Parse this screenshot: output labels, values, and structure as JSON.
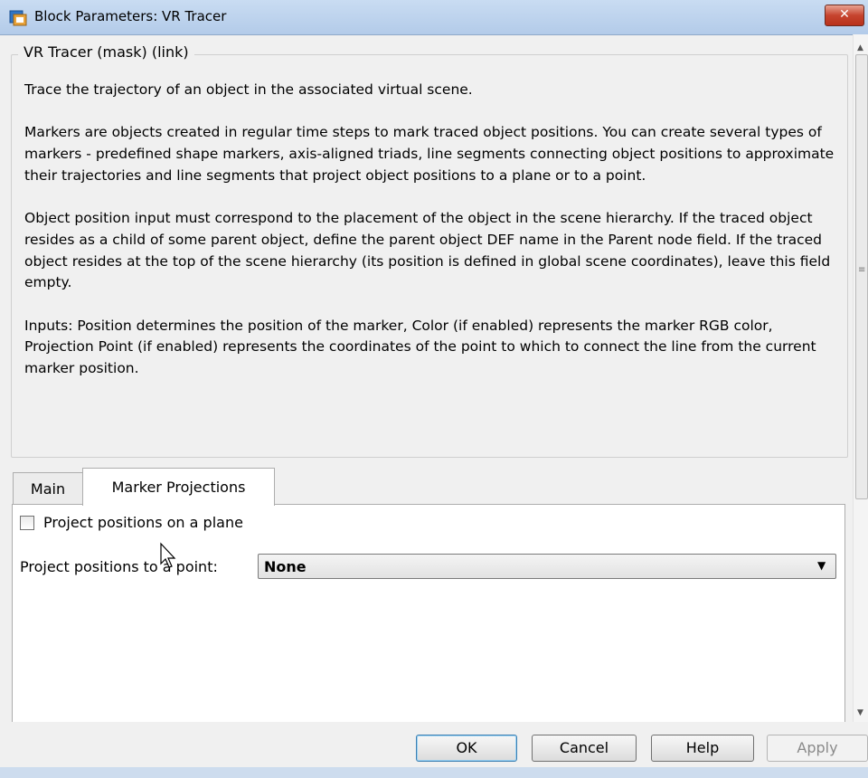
{
  "window": {
    "title": "Block Parameters: VR Tracer",
    "close_label": "✕"
  },
  "description": {
    "legend": "VR Tracer (mask) (link)",
    "paragraphs": [
      "Trace the trajectory of an object in the associated virtual scene.",
      "Markers are objects created in regular time steps to mark traced object positions. You can create several types of markers - predefined shape markers, axis-aligned triads, line segments connecting object positions to approximate their trajectories and line segments that project object positions to a plane or to a point.",
      "Object position input must correspond to the placement of the object in the scene hierarchy. If the traced object resides as a child of some parent object, define the parent object DEF name in the Parent node field. If the traced object resides at the top of the scene hierarchy (its position is defined in global scene coordinates), leave this field empty.",
      "Inputs: Position determines the position of the marker, Color (if enabled) represents the marker RGB color, Projection Point (if enabled) represents the coordinates of the point to which to connect the line from the current marker position."
    ]
  },
  "tabs": [
    {
      "label": "Main",
      "active": false
    },
    {
      "label": "Marker Projections",
      "active": true
    }
  ],
  "marker_projections": {
    "plane_checkbox": {
      "label": "Project positions on a plane",
      "checked": false
    },
    "point_select": {
      "label": "Project positions to a point:",
      "value": "None"
    }
  },
  "buttons": {
    "ok": "OK",
    "cancel": "Cancel",
    "help": "Help",
    "apply": "Apply"
  },
  "colors": {
    "titlebar": "#b9d1ea",
    "close_button": "#c74631",
    "panel_background": "#f0f0f0"
  }
}
